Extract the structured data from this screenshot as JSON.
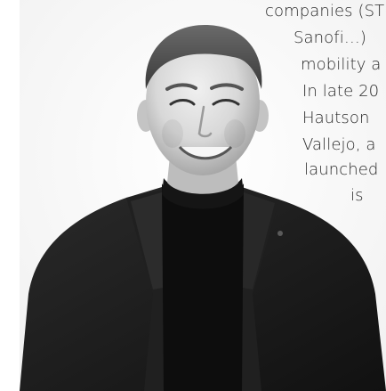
{
  "bio": {
    "lines": [
      "companies (ST",
      "Sanofi…)",
      "mobility a",
      "In late 20",
      "Hautson",
      "Vallejo, a",
      "launched",
      "is"
    ]
  },
  "photo": {
    "subject": "portrait-photo"
  },
  "colors": {
    "background": "#ffffff",
    "text": "#2a2a2a",
    "jacket": "#1c1c1c",
    "sweater": "#0d0d0d"
  }
}
